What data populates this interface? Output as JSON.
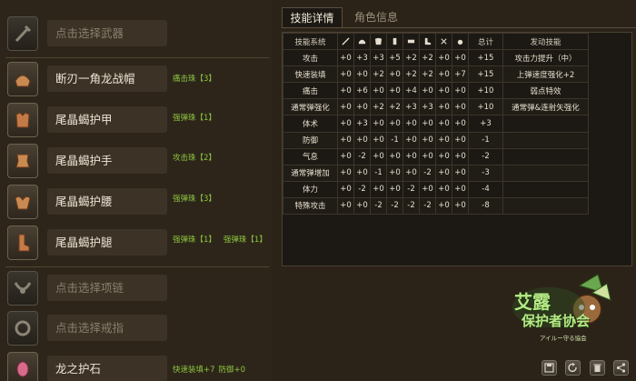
{
  "weapon_slot": {
    "placeholder": "点击选择武器"
  },
  "armor": [
    {
      "name": "断刃一角龙战帽",
      "tags": [
        "痛击珠【3】"
      ]
    },
    {
      "name": "尾晶蝎护甲",
      "tags": [
        "强弹珠【1】"
      ]
    },
    {
      "name": "尾晶蝎护手",
      "tags": [
        "攻击珠【2】"
      ]
    },
    {
      "name": "尾晶蝎护腰",
      "tags": [
        "强弹珠【3】"
      ]
    },
    {
      "name": "尾晶蝎护腿",
      "tags": [
        "强弹珠【1】",
        "强弹珠【1】"
      ]
    }
  ],
  "accessories": [
    {
      "placeholder": "点击选择项链"
    },
    {
      "placeholder": "点击选择戒指"
    }
  ],
  "charm": {
    "name": "龙之护石",
    "tags": [
      "快速装填+7",
      "防御+0"
    ]
  },
  "tabs": {
    "active": "技能详情",
    "inactive": "角色信息"
  },
  "table": {
    "col_skill": "技能系统",
    "col_total": "总计",
    "col_activate": "发动技能",
    "header_icons": [
      "weapon-icon",
      "helmet-icon",
      "chest-icon",
      "arm-icon",
      "waist-icon",
      "legs-icon",
      "charm-icon",
      "decoration-icon"
    ],
    "rows": [
      {
        "skill": "攻击",
        "vals": [
          "+0",
          "+3",
          "+3",
          "+5",
          "+2",
          "+2",
          "+0",
          "+0"
        ],
        "total": "+15",
        "effect": "攻击力提升（中）"
      },
      {
        "skill": "快速装填",
        "vals": [
          "+0",
          "+0",
          "+2",
          "+0",
          "+2",
          "+2",
          "+0",
          "+7"
        ],
        "total": "+15",
        "effect": "上弹速度强化+2"
      },
      {
        "skill": "痛击",
        "vals": [
          "+0",
          "+6",
          "+0",
          "+0",
          "+4",
          "+0",
          "+0",
          "+0"
        ],
        "total": "+10",
        "effect": "弱点特效"
      },
      {
        "skill": "通常弹强化",
        "vals": [
          "+0",
          "+0",
          "+2",
          "+2",
          "+3",
          "+3",
          "+0",
          "+0"
        ],
        "total": "+10",
        "effect": "通常弹&连射矢强化"
      },
      {
        "skill": "体术",
        "vals": [
          "+0",
          "+3",
          "+0",
          "+0",
          "+0",
          "+0",
          "+0",
          "+0"
        ],
        "total": "+3",
        "effect": ""
      },
      {
        "skill": "防御",
        "vals": [
          "+0",
          "+0",
          "+0",
          "-1",
          "+0",
          "+0",
          "+0",
          "+0"
        ],
        "total": "-1",
        "effect": ""
      },
      {
        "skill": "气息",
        "vals": [
          "+0",
          "-2",
          "+0",
          "+0",
          "+0",
          "+0",
          "+0",
          "+0"
        ],
        "total": "-2",
        "effect": ""
      },
      {
        "skill": "通常弹增加",
        "vals": [
          "+0",
          "+0",
          "-1",
          "+0",
          "+0",
          "-2",
          "+0",
          "+0"
        ],
        "total": "-3",
        "effect": ""
      },
      {
        "skill": "体力",
        "vals": [
          "+0",
          "-2",
          "+0",
          "+0",
          "-2",
          "+0",
          "+0",
          "+0"
        ],
        "total": "-4",
        "effect": ""
      },
      {
        "skill": "特殊攻击",
        "vals": [
          "+0",
          "+0",
          "-2",
          "-2",
          "-2",
          "-2",
          "+0",
          "+0"
        ],
        "total": "-8",
        "effect": ""
      }
    ]
  },
  "logo": {
    "line1": "艾露",
    "line2": "保护者协会",
    "line3": "アイルー守る協会"
  },
  "buttons": [
    "save-icon",
    "refresh-icon",
    "trash-icon",
    "share-icon"
  ]
}
